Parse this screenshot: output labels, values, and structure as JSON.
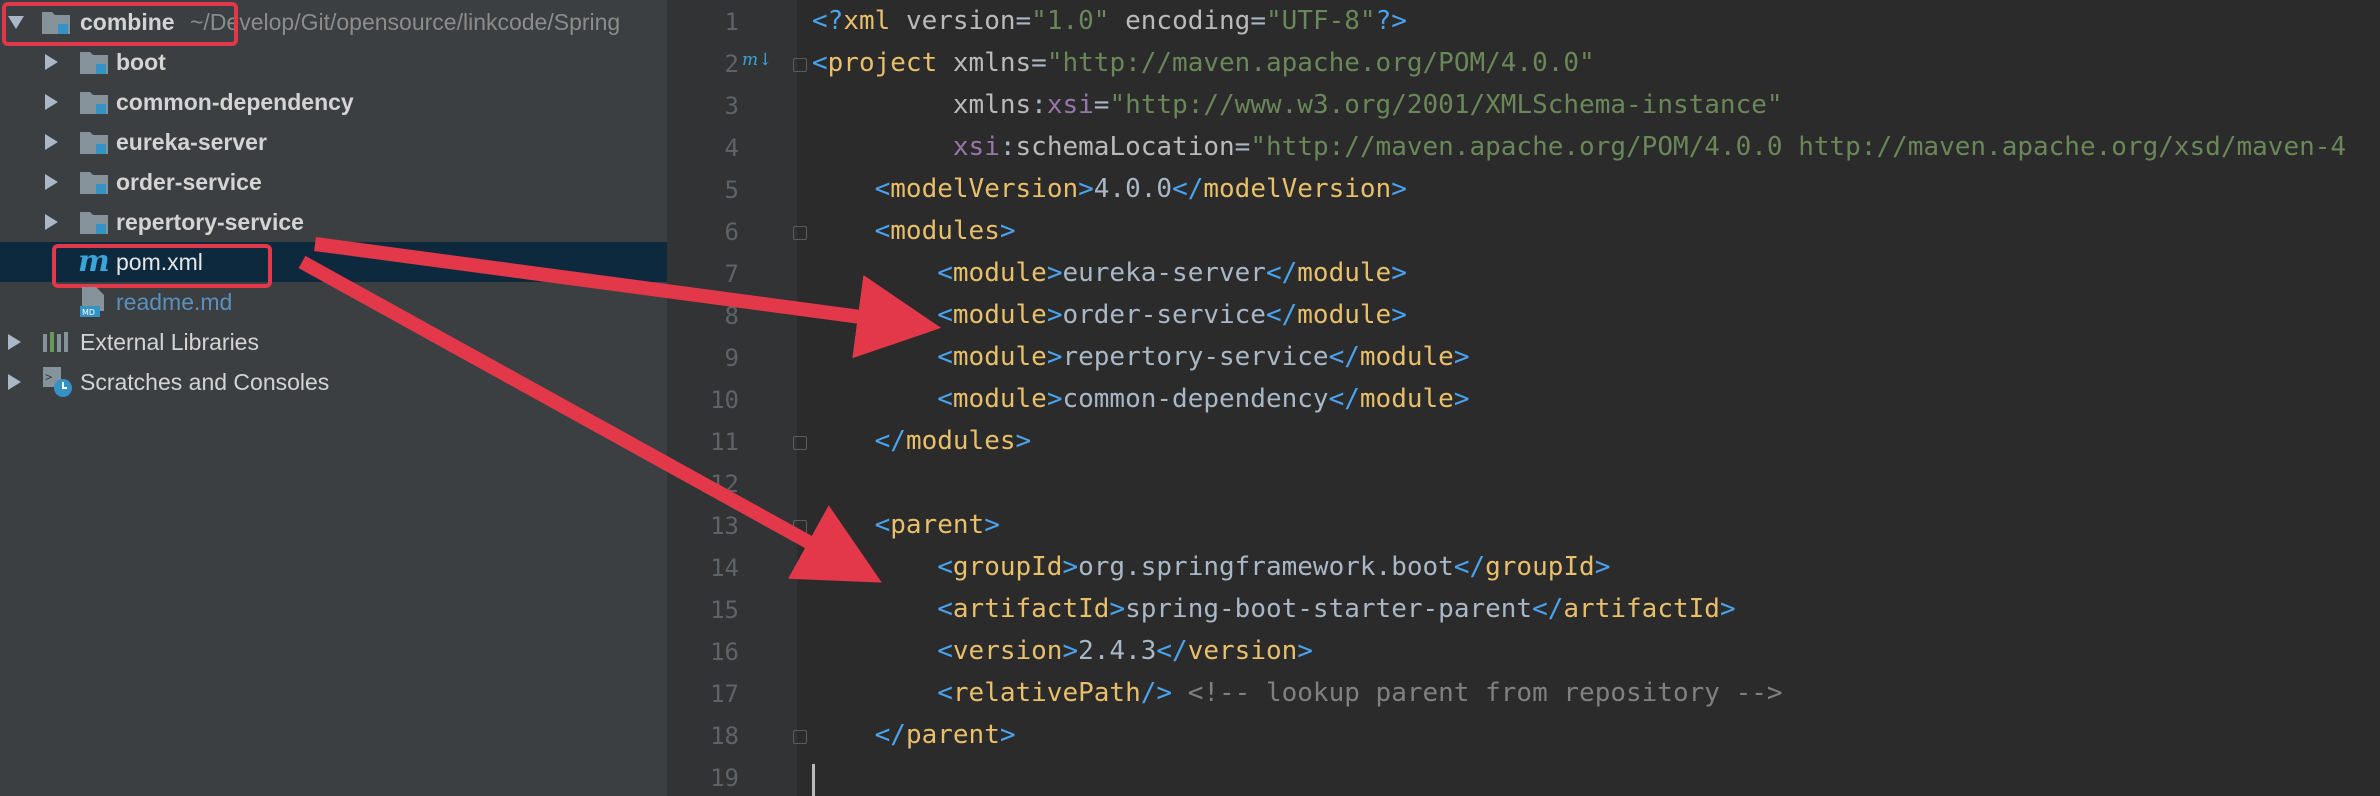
{
  "project_tree": {
    "root": {
      "name": "combine",
      "path": "~/Develop/Git/opensource/linkcode/Spring"
    },
    "folders": [
      "boot",
      "common-dependency",
      "eureka-server",
      "order-service",
      "repertory-service"
    ],
    "files": [
      {
        "name": "pom.xml",
        "icon": "maven-icon"
      },
      {
        "name": "readme.md",
        "icon": "markdown-icon"
      }
    ],
    "extra": [
      "External Libraries",
      "Scratches and Consoles"
    ]
  },
  "editor": {
    "line_numbers": [
      "1",
      "2",
      "3",
      "4",
      "5",
      "6",
      "7",
      "8",
      "9",
      "10",
      "11",
      "12",
      "13",
      "14",
      "15",
      "16",
      "17",
      "18",
      "19"
    ],
    "lines": [
      [
        [
          "br",
          "<?"
        ],
        [
          "tg",
          "xml "
        ],
        [
          "at",
          "version"
        ],
        [
          "tx",
          "="
        ],
        [
          "st",
          "\"1.0\""
        ],
        [
          "tx",
          " "
        ],
        [
          "at",
          "encoding"
        ],
        [
          "tx",
          "="
        ],
        [
          "st",
          "\"UTF-8\""
        ],
        [
          "br",
          "?>"
        ]
      ],
      [
        [
          "br",
          "<"
        ],
        [
          "tg",
          "project "
        ],
        [
          "at",
          "xmlns"
        ],
        [
          "tx",
          "="
        ],
        [
          "st",
          "\"http://maven.apache.org/POM/4.0.0\""
        ]
      ],
      [
        [
          "tx",
          "         "
        ],
        [
          "at",
          "xmlns"
        ],
        [
          "tx",
          ":"
        ],
        [
          "ns",
          "xsi"
        ],
        [
          "tx",
          "="
        ],
        [
          "st",
          "\"http://www.w3.org/2001/XMLSchema-instance\""
        ]
      ],
      [
        [
          "tx",
          "         "
        ],
        [
          "ns",
          "xsi"
        ],
        [
          "tx",
          ":"
        ],
        [
          "at",
          "schemaLocation"
        ],
        [
          "tx",
          "="
        ],
        [
          "st",
          "\"http://maven.apache.org/POM/4.0.0 http://maven.apache.org/xsd/maven-4"
        ]
      ],
      [
        [
          "tx",
          "    "
        ],
        [
          "br",
          "<"
        ],
        [
          "tg",
          "modelVersion"
        ],
        [
          "br",
          ">"
        ],
        [
          "tx",
          "4.0.0"
        ],
        [
          "br",
          "</"
        ],
        [
          "tg",
          "modelVersion"
        ],
        [
          "br",
          ">"
        ]
      ],
      [
        [
          "tx",
          "    "
        ],
        [
          "br",
          "<"
        ],
        [
          "tg",
          "modules"
        ],
        [
          "br",
          ">"
        ]
      ],
      [
        [
          "tx",
          "        "
        ],
        [
          "br",
          "<"
        ],
        [
          "tg",
          "module"
        ],
        [
          "br",
          ">"
        ],
        [
          "tx",
          "eureka-server"
        ],
        [
          "br",
          "</"
        ],
        [
          "tg",
          "module"
        ],
        [
          "br",
          ">"
        ]
      ],
      [
        [
          "tx",
          "        "
        ],
        [
          "br",
          "<"
        ],
        [
          "tg",
          "module"
        ],
        [
          "br",
          ">"
        ],
        [
          "tx",
          "order-service"
        ],
        [
          "br",
          "</"
        ],
        [
          "tg",
          "module"
        ],
        [
          "br",
          ">"
        ]
      ],
      [
        [
          "tx",
          "        "
        ],
        [
          "br",
          "<"
        ],
        [
          "tg",
          "module"
        ],
        [
          "br",
          ">"
        ],
        [
          "tx",
          "repertory-service"
        ],
        [
          "br",
          "</"
        ],
        [
          "tg",
          "module"
        ],
        [
          "br",
          ">"
        ]
      ],
      [
        [
          "tx",
          "        "
        ],
        [
          "br",
          "<"
        ],
        [
          "tg",
          "module"
        ],
        [
          "br",
          ">"
        ],
        [
          "tx",
          "common-dependency"
        ],
        [
          "br",
          "</"
        ],
        [
          "tg",
          "module"
        ],
        [
          "br",
          ">"
        ]
      ],
      [
        [
          "tx",
          "    "
        ],
        [
          "br",
          "</"
        ],
        [
          "tg",
          "modules"
        ],
        [
          "br",
          ">"
        ]
      ],
      [],
      [
        [
          "tx",
          "    "
        ],
        [
          "br",
          "<"
        ],
        [
          "tg",
          "parent"
        ],
        [
          "br",
          ">"
        ]
      ],
      [
        [
          "tx",
          "        "
        ],
        [
          "br",
          "<"
        ],
        [
          "tg",
          "groupId"
        ],
        [
          "br",
          ">"
        ],
        [
          "tx",
          "org.springframework.boot"
        ],
        [
          "br",
          "</"
        ],
        [
          "tg",
          "groupId"
        ],
        [
          "br",
          ">"
        ]
      ],
      [
        [
          "tx",
          "        "
        ],
        [
          "br",
          "<"
        ],
        [
          "tg",
          "artifactId"
        ],
        [
          "br",
          ">"
        ],
        [
          "tx",
          "spring-boot-starter-parent"
        ],
        [
          "br",
          "</"
        ],
        [
          "tg",
          "artifactId"
        ],
        [
          "br",
          ">"
        ]
      ],
      [
        [
          "tx",
          "        "
        ],
        [
          "br",
          "<"
        ],
        [
          "tg",
          "version"
        ],
        [
          "br",
          ">"
        ],
        [
          "tx",
          "2.4.3"
        ],
        [
          "br",
          "</"
        ],
        [
          "tg",
          "version"
        ],
        [
          "br",
          ">"
        ]
      ],
      [
        [
          "tx",
          "        "
        ],
        [
          "br",
          "<"
        ],
        [
          "tg",
          "relativePath"
        ],
        [
          "br",
          "/>"
        ],
        [
          "tx",
          " "
        ],
        [
          "cm",
          "<!-- lookup parent from repository -->"
        ]
      ],
      [
        [
          "tx",
          "    "
        ],
        [
          "br",
          "</"
        ],
        [
          "tg",
          "parent"
        ],
        [
          "br",
          ">"
        ]
      ],
      []
    ]
  },
  "colors": {
    "highlight_red": "#e2384a",
    "selection": "#0d293e"
  }
}
